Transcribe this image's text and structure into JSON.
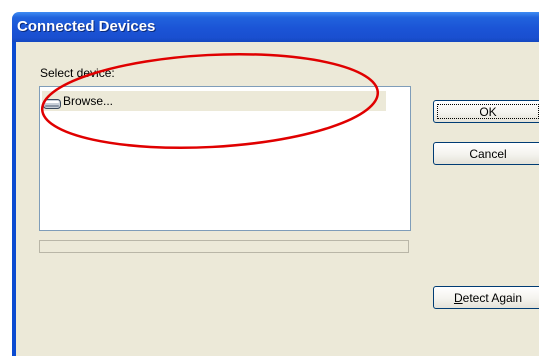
{
  "window": {
    "title": "Connected Devices"
  },
  "device_list": {
    "label": "Select device:",
    "items": [
      {
        "label": "Browse...",
        "icon": "drive-icon",
        "selected": true
      }
    ]
  },
  "progress": {
    "value": 0
  },
  "buttons": {
    "ok": "OK",
    "cancel": "Cancel",
    "detect_again": "Detect Again"
  },
  "annotation": {
    "shape": "ellipse",
    "color": "#e00000",
    "highlights": "device-list-item-browse"
  },
  "colors": {
    "titlebar": "#1b54d6",
    "dialog_background": "#ece9d8",
    "button_border": "#003c74"
  }
}
